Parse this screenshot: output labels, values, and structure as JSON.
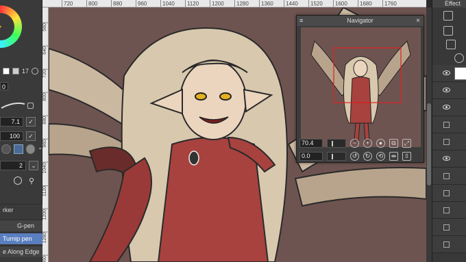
{
  "left_panel": {
    "size_value": "17",
    "field_zero": "0",
    "brush_size": "7.1",
    "opacity": "100",
    "stabilization": "2",
    "subtool_header": "rker",
    "subtools": [
      {
        "label": "G-pen",
        "selected": false
      },
      {
        "label": "Turnip pen",
        "selected": true
      },
      {
        "label": "e Along Edge",
        "selected": false
      }
    ]
  },
  "ruler": {
    "marks": [
      "720",
      "800",
      "880",
      "960",
      "1040",
      "1120",
      "1200",
      "1280",
      "1360",
      "1440",
      "1520",
      "1600",
      "1680",
      "1760"
    ]
  },
  "vruler": {
    "marks": [
      "560",
      "640",
      "720",
      "800",
      "880",
      "960",
      "1040",
      "1120",
      "1200",
      "1280",
      "1360"
    ]
  },
  "navigator": {
    "title": "Navigator",
    "zoom_value": "70.4",
    "rotation_value": "0.0"
  },
  "right_panel": {
    "title": "Effect"
  },
  "colors": {
    "canvas_bg": "#6e5450",
    "accent_selected": "#5a7fc0",
    "nav_frame": "#e02020"
  }
}
